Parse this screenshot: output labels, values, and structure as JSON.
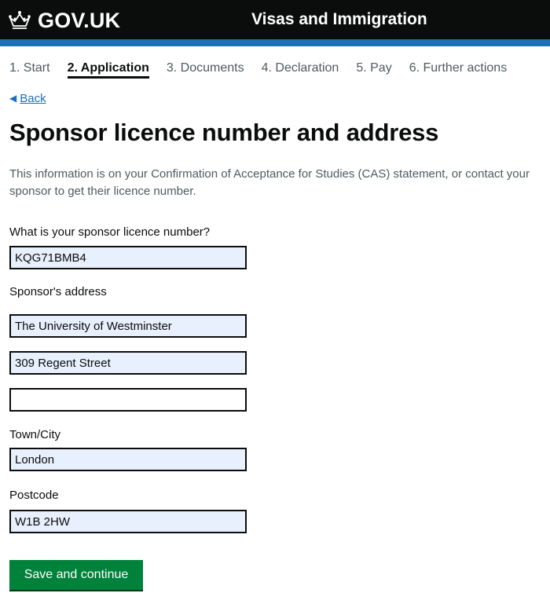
{
  "header": {
    "brand": "GOV.UK",
    "service": "Visas and Immigration"
  },
  "steps": [
    {
      "label": "1. Start",
      "active": false
    },
    {
      "label": "2. Application",
      "active": true
    },
    {
      "label": "3. Documents",
      "active": false
    },
    {
      "label": "4. Declaration",
      "active": false
    },
    {
      "label": "5. Pay",
      "active": false
    },
    {
      "label": "6. Further actions",
      "active": false
    }
  ],
  "back": {
    "label": "Back"
  },
  "page": {
    "title": "Sponsor licence number and address",
    "intro": "This information is on your Confirmation of Acceptance for Studies (CAS) statement, or contact your sponsor to get their licence number."
  },
  "form": {
    "licence_label": "What is your sponsor licence number?",
    "licence_value": "KQG71BMB4",
    "address_label": "Sponsor's address",
    "address_line1": "The University of Westminster",
    "address_line2": "309 Regent Street",
    "address_line3": "",
    "town_label": "Town/City",
    "town_value": "London",
    "postcode_label": "Postcode",
    "postcode_value": "W1B 2HW",
    "submit_label": "Save and continue"
  },
  "colors": {
    "header_bg": "#0b0c0c",
    "accent_blue": "#1d70b8",
    "button_green": "#00823b",
    "autofill_bg": "#e8f0fe"
  }
}
